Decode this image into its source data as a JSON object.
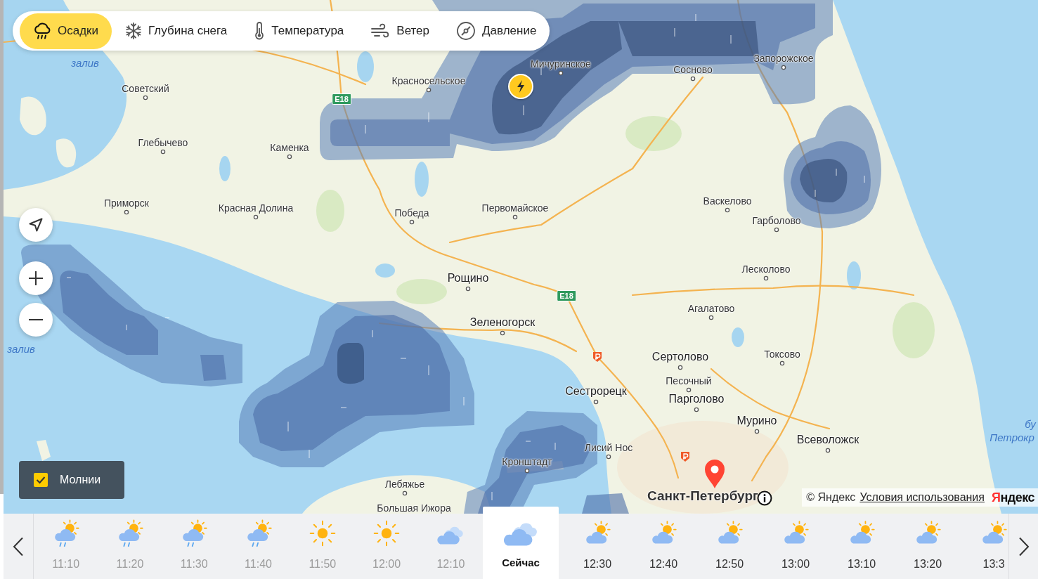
{
  "layer_tabs": [
    {
      "label": "Осадки",
      "selected": true
    },
    {
      "label": "Глубина снега",
      "selected": false
    },
    {
      "label": "Температура",
      "selected": false
    },
    {
      "label": "Ветер",
      "selected": false
    },
    {
      "label": "Давление",
      "selected": false
    }
  ],
  "map": {
    "labels": [
      {
        "text": "залив",
        "kind": "water"
      },
      {
        "text": "Советский",
        "kind": "village"
      },
      {
        "text": "Глебычево",
        "kind": "village"
      },
      {
        "text": "Каменка",
        "kind": "village"
      },
      {
        "text": "Красносельское",
        "kind": "village"
      },
      {
        "text": "Мичуринское",
        "kind": "village"
      },
      {
        "text": "Сосново",
        "kind": "village"
      },
      {
        "text": "Запорожское",
        "kind": "village"
      },
      {
        "text": "Приморск",
        "kind": "village"
      },
      {
        "text": "Красная Долина",
        "kind": "village"
      },
      {
        "text": "Победа",
        "kind": "village"
      },
      {
        "text": "Первомайское",
        "kind": "village"
      },
      {
        "text": "Васкелово",
        "kind": "village"
      },
      {
        "text": "Гарболово",
        "kind": "village"
      },
      {
        "text": "Лесколово",
        "kind": "village"
      },
      {
        "text": "Рощино",
        "kind": "town"
      },
      {
        "text": "Агалатово",
        "kind": "village"
      },
      {
        "text": "Зеленогорск",
        "kind": "town"
      },
      {
        "text": "залив",
        "kind": "water"
      },
      {
        "text": "Сертолово",
        "kind": "town"
      },
      {
        "text": "Токсово",
        "kind": "village"
      },
      {
        "text": "Песочный",
        "kind": "village"
      },
      {
        "text": "Сестрорецк",
        "kind": "town"
      },
      {
        "text": "Парголово",
        "kind": "town"
      },
      {
        "text": "Мурино",
        "kind": "town"
      },
      {
        "text": "бу",
        "kind": "water"
      },
      {
        "text": "Всеволожск",
        "kind": "town"
      },
      {
        "text": "Петрокр",
        "kind": "water"
      },
      {
        "text": "Лисий Нос",
        "kind": "village"
      },
      {
        "text": "Кронштадт",
        "kind": "village"
      },
      {
        "text": "Лебяжье",
        "kind": "village"
      },
      {
        "text": "Большая Ижора",
        "kind": "village"
      },
      {
        "text": "Санкт-Петербург",
        "kind": "city"
      }
    ],
    "route_signs": [
      "E18",
      "E18"
    ]
  },
  "lightning_toggle": {
    "label": "Молнии",
    "checked": true
  },
  "attribution": {
    "copyright": "© Яндекс",
    "terms_link": "Условия использования",
    "logo": "Яндекс"
  },
  "timeline": {
    "items": [
      {
        "time": "11:10",
        "kind": "rain_sun",
        "past": true,
        "selected": false
      },
      {
        "time": "11:20",
        "kind": "rain_sun",
        "past": true,
        "selected": false
      },
      {
        "time": "11:30",
        "kind": "rain_sun",
        "past": true,
        "selected": false
      },
      {
        "time": "11:40",
        "kind": "rain_sun",
        "past": true,
        "selected": false
      },
      {
        "time": "11:50",
        "kind": "sun",
        "past": true,
        "selected": false
      },
      {
        "time": "12:00",
        "kind": "sun",
        "past": true,
        "selected": false
      },
      {
        "time": "12:10",
        "kind": "cloudy",
        "past": true,
        "selected": false
      },
      {
        "time": "Сейчас",
        "kind": "cloudy",
        "past": false,
        "selected": true
      },
      {
        "time": "12:30",
        "kind": "cloud_sun",
        "past": false,
        "selected": false
      },
      {
        "time": "12:40",
        "kind": "cloud_sun",
        "past": false,
        "selected": false
      },
      {
        "time": "12:50",
        "kind": "cloud_sun",
        "past": false,
        "selected": false
      },
      {
        "time": "13:00",
        "kind": "cloud_sun",
        "past": false,
        "selected": false
      },
      {
        "time": "13:10",
        "kind": "cloud_sun",
        "past": false,
        "selected": false
      },
      {
        "time": "13:20",
        "kind": "cloud_sun",
        "past": false,
        "selected": false
      },
      {
        "time": "13:3",
        "kind": "cloud_sun",
        "past": false,
        "selected": false
      }
    ]
  }
}
